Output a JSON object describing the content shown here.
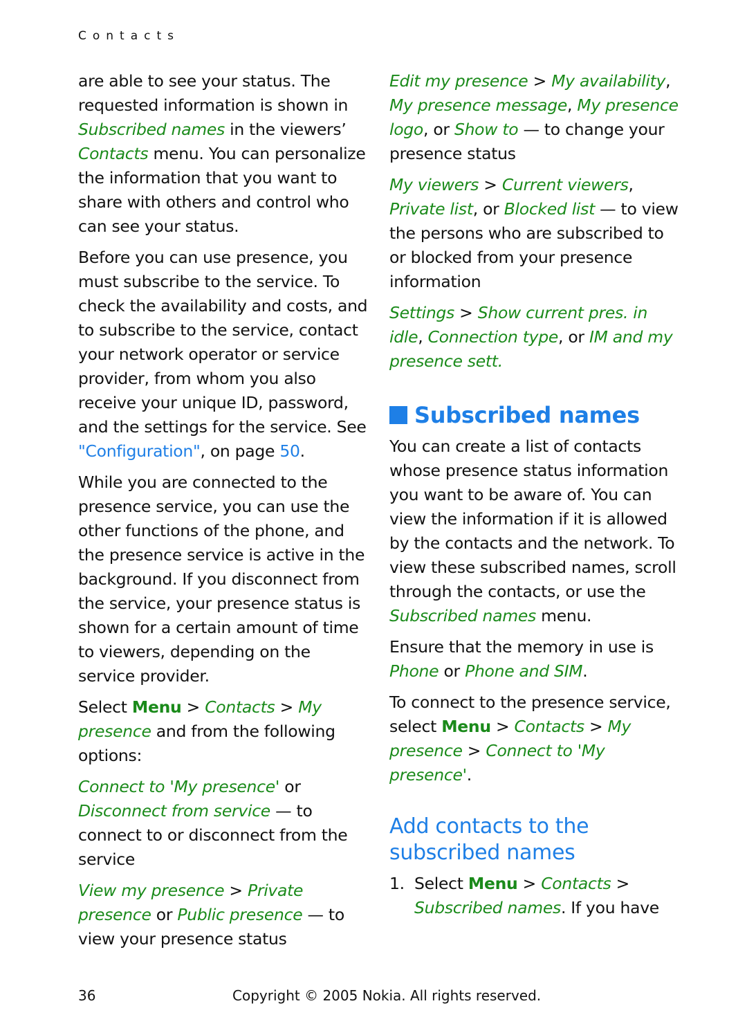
{
  "header": {
    "section": "Contacts"
  },
  "left_column": {
    "p1": {
      "t1": "are able to see your status. The requested information is shown in ",
      "g1": "Subscribed names",
      "t2": " in the viewers’ ",
      "g2": "Contacts",
      "t3": " menu. You can personalize the information that you want to share with others and control who can see your status."
    },
    "p2": {
      "t1": "Before you can use presence, you must subscribe to the service. To check the availability and costs, and to subscribe to the service, contact your network operator or service provider, from whom you also receive your unique ID, password, and the settings for the service. See ",
      "link": "\"Configuration\"",
      "t2": ", on page ",
      "page_link": "50",
      "t3": "."
    },
    "p3": "While you are connected to the presence service, you can use the other functions of the phone, and the presence service is active in the background. If you disconnect from the service, your presence status is shown for a certain amount of time to viewers, depending on the service provider.",
    "p4": {
      "t1": "Select ",
      "menu": "Menu",
      "sep1": " > ",
      "g1": "Contacts",
      "sep2": " > ",
      "g2": "My presence",
      "t2": " and from the following options:"
    },
    "opt1": {
      "g1": "Connect to 'My presence'",
      "t1": " or ",
      "g2": "Disconnect from service",
      "t2": " — to connect to or disconnect from the service"
    },
    "opt2": {
      "g1": "View my presence",
      "sep": " > ",
      "g2": "Private presence",
      "t1": " or ",
      "g3": "Public presence",
      "t2": " — to view your presence status"
    }
  },
  "right_column": {
    "opt3": {
      "g1": "Edit my presence",
      "sep": " > ",
      "g2": "My availability",
      "c1": ", ",
      "g3": "My presence message",
      "c2": ", ",
      "g4": "My presence logo",
      "t1": ", or ",
      "g5": "Show to",
      "t2": " — to change your presence status"
    },
    "opt4": {
      "g1": "My viewers",
      "sep": " > ",
      "g2": "Current viewers",
      "c1": ", ",
      "g3": "Private list",
      "t1": ", or ",
      "g4": "Blocked list",
      "t2": " — to view the persons who are subscribed to or blocked from your presence information"
    },
    "opt5": {
      "g1": "Settings",
      "sep": " > ",
      "g2": "Show current pres. in idle",
      "c1": ", ",
      "g3": "Connection type",
      "t1": ", or ",
      "g4": "IM and my presence sett."
    },
    "heading": "Subscribed names",
    "p1": {
      "t1": "You can create a list of contacts whose presence status information you want to be aware of. You can view the information if it is allowed by the contacts and the network. To view these subscribed names, scroll through the contacts, or use the ",
      "g1": "Subscribed names",
      "t2": " menu."
    },
    "p2": {
      "t1": "Ensure that the memory in use is ",
      "g1": "Phone",
      "t2": " or ",
      "g2": "Phone and SIM",
      "t3": "."
    },
    "p3": {
      "t1": "To connect to the presence service, select ",
      "menu": "Menu",
      "sep1": " > ",
      "g1": "Contacts",
      "sep2": " > ",
      "g2": "My presence",
      "sep3": " > ",
      "g3": "Connect to 'My presence'",
      "t2": "."
    },
    "subheading": "Add contacts to the subscribed names",
    "step1": {
      "num": "1.",
      "t1": "Select ",
      "menu": "Menu",
      "sep1": " > ",
      "g1": "Contacts",
      "sep2": " > ",
      "g2": "Subscribed names",
      "t2": ". If you have"
    }
  },
  "footer": {
    "page_number": "36",
    "copyright": "Copyright © 2005 Nokia. All rights reserved."
  },
  "colors": {
    "menu_green": "#1a8a1a",
    "heading_blue": "#1e7fe6",
    "text": "#111111"
  }
}
